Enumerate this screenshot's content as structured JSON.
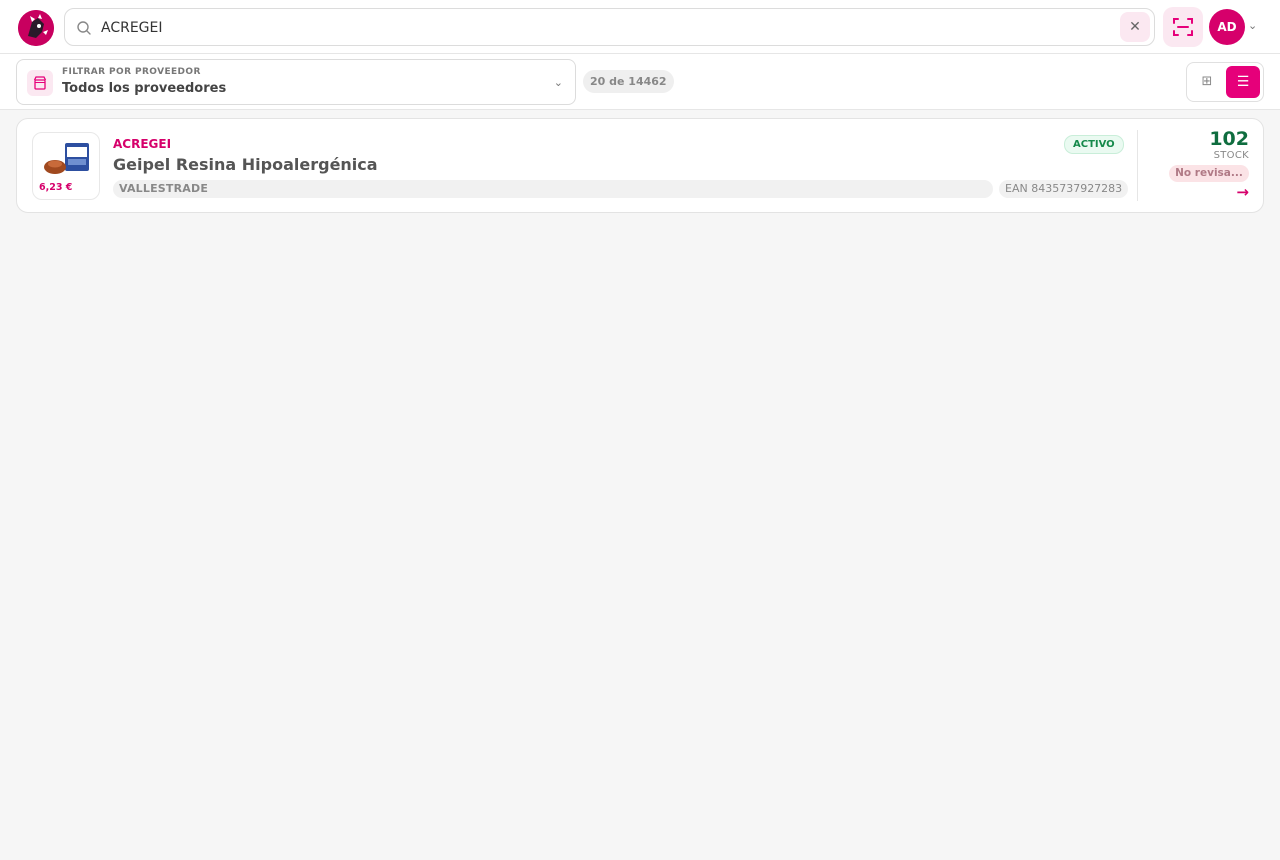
{
  "header": {
    "logo_name": "brand-logo",
    "search": {
      "value": "ACREGEI",
      "placeholder": ""
    },
    "clear_label": "✕",
    "avatar_initials": "AD",
    "avatar_chevron": "⌄"
  },
  "filters": {
    "provider_label": "FILTRAR POR PROVEEDOR",
    "provider_value": "Todos los proveedores",
    "select_chevron": "⌄",
    "count_text": "20 de 14462",
    "grid_icon": "⊞",
    "list_icon": "☰"
  },
  "products": [
    {
      "code": "ACREGEI",
      "name": "Geipel Resina Hipoalergénica",
      "price": "6,23 €",
      "supplier": "VALLESTRADE",
      "ean": "EAN 8435737927283",
      "status": "ACTIVO",
      "stock": "102",
      "stock_label": "STOCK",
      "review": "No revisa...",
      "arrow": "→"
    }
  ],
  "colors": {
    "brand": "#e6007a",
    "status_active": "#14894a",
    "stock": "#0f6d3f"
  }
}
